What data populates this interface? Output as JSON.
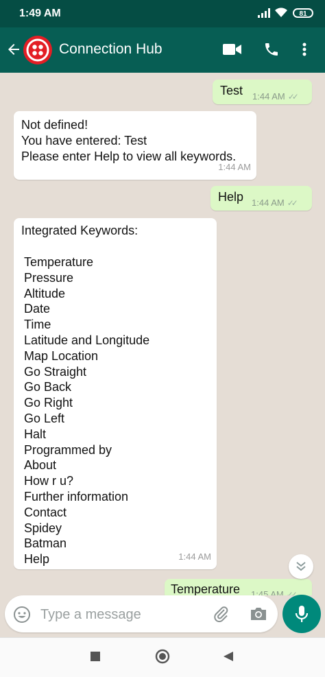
{
  "status_bar": {
    "time": "1:49 AM",
    "battery": "81"
  },
  "header": {
    "title": "Connection Hub"
  },
  "messages": [
    {
      "dir": "out",
      "text": "Test",
      "time": "1:44 AM"
    },
    {
      "dir": "in",
      "text": "Not defined!\nYou have entered: Test\nPlease enter Help to view all keywords.",
      "time": "1:44 AM"
    },
    {
      "dir": "out",
      "text": "Help",
      "time": "1:44 AM"
    },
    {
      "dir": "in",
      "heading": "Integrated Keywords:",
      "keywords": [
        "Temperature",
        "Pressure",
        "Altitude",
        "Date",
        "Time",
        "Latitude and Longitude",
        "Map Location",
        "Go Straight",
        "Go Back",
        "Go Right",
        "Go Left",
        "Halt",
        "Programmed by",
        "About",
        "How r u?",
        "Further information",
        "Contact",
        "Spidey",
        "Batman",
        "Help"
      ],
      "time": "1:44 AM"
    },
    {
      "dir": "out",
      "text": "Temperature",
      "time": "1:45 AM"
    }
  ],
  "composer": {
    "placeholder": "Type a message",
    "value": ""
  },
  "colors": {
    "header": "#075e54",
    "outgoing_bubble": "#dcf8c6",
    "incoming_bubble": "#ffffff",
    "chat_background": "#e5ddd5",
    "mic_button": "#00897b"
  },
  "icons": [
    "signal-icon",
    "wifi-icon",
    "battery-icon",
    "back-arrow-icon",
    "video-call-icon",
    "phone-icon",
    "more-vert-icon",
    "double-check-icon",
    "scroll-down-icon",
    "emoji-icon",
    "attach-icon",
    "camera-icon",
    "mic-icon",
    "nav-recents-icon",
    "nav-home-icon",
    "nav-back-icon"
  ]
}
